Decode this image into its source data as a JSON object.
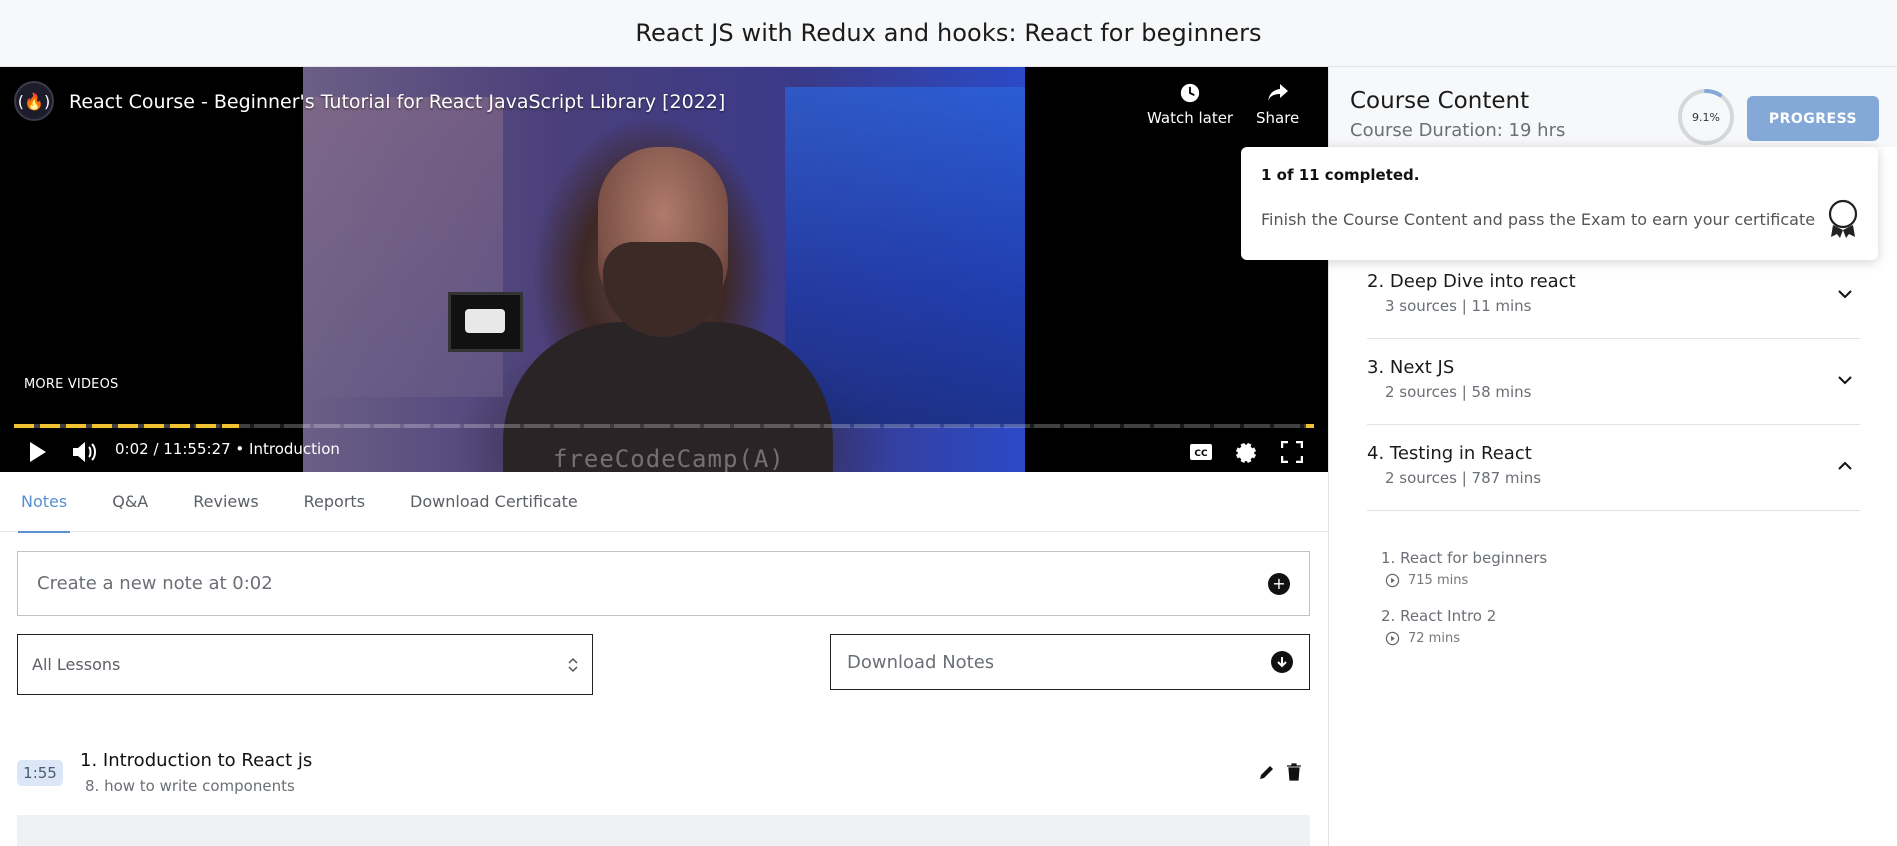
{
  "header": {
    "title": "React JS with Redux and hooks: React for beginners"
  },
  "video": {
    "logo_glyph": "(🔥)",
    "title": "React Course - Beginner's Tutorial for React JavaScript Library [2022]",
    "watch_later_label": "Watch later",
    "share_label": "Share",
    "more_videos_label": "MORE VIDEOS",
    "time_current": "0:02",
    "time_total": "11:55:27",
    "chapter": "Introduction",
    "watermark": "freeCodeCamp(A)",
    "accent_color": "#f1c232"
  },
  "tabs": [
    {
      "label": "Notes",
      "active": true
    },
    {
      "label": "Q&A"
    },
    {
      "label": "Reviews"
    },
    {
      "label": "Reports"
    },
    {
      "label": "Download Certificate"
    }
  ],
  "notes": {
    "new_note_placeholder": "Create a new note at 0:02",
    "lesson_filter": "All Lessons",
    "download_label": "Download Notes",
    "items": [
      {
        "timestamp": "1:55",
        "title": "1. Introduction to React js",
        "subtitle": "8. how to write components"
      }
    ]
  },
  "sidebar": {
    "title": "Course Content",
    "duration": "Course Duration: 19 hrs",
    "progress_percent": "9.1%",
    "progress_fraction": 0.091,
    "progress_button": "PROGRESS",
    "popover": {
      "completed": "1 of 11 completed.",
      "message": "Finish the Course Content and pass the Exam to earn your certificate"
    },
    "sections": [
      {
        "name": "2. Deep Dive into react",
        "meta": "3 sources | 11 mins",
        "expanded": false
      },
      {
        "name": "3. Next JS",
        "meta": "2 sources | 58 mins",
        "expanded": false
      },
      {
        "name": "4. Testing in React",
        "meta": "2 sources | 787 mins",
        "expanded": true
      }
    ],
    "lessons": [
      {
        "name": "1. React for beginners",
        "duration": "715 mins"
      },
      {
        "name": "2. React Intro 2",
        "duration": "72 mins"
      }
    ]
  },
  "colors": {
    "accent_blue": "#5b8fd1",
    "progress_button_bg": "#84a9d9",
    "timestamp_bg": "#dbe7f7"
  }
}
